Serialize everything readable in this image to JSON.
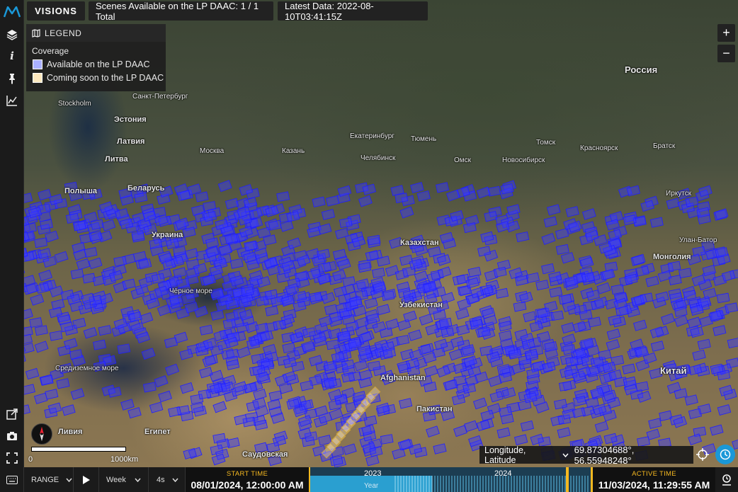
{
  "app": {
    "logo_icon": "m-logo-icon",
    "brand_color": "#1a98d8",
    "accent_color": "#f5b820"
  },
  "header": {
    "visions_label": "VISIONS",
    "scenes_text": "Scenes Available on the LP DAAC: 1 / 1 Total",
    "latest_data_text": "Latest Data: 2022-08-10T03:41:15Z"
  },
  "sidebar": {
    "tools": [
      {
        "icon": "layers-icon"
      },
      {
        "icon": "info-icon"
      },
      {
        "icon": "pin-icon"
      },
      {
        "icon": "chart-icon"
      }
    ],
    "bottom_tools": [
      {
        "icon": "external-link-icon"
      },
      {
        "icon": "camera-icon"
      },
      {
        "icon": "fullscreen-icon"
      },
      {
        "icon": "keyboard-icon"
      }
    ]
  },
  "legend": {
    "title": "LEGEND",
    "subtitle": "Coverage",
    "items": [
      {
        "label": "Available on the LP DAAC",
        "color": "#aab0ff"
      },
      {
        "label": "Coming soon to the LP DAAC",
        "color": "#fde9bf"
      }
    ]
  },
  "map": {
    "coverage_color": "#2020ff",
    "coming_soon_color": "#d4a630",
    "places": [
      {
        "name": "Россия"
      },
      {
        "name": "Полыша"
      },
      {
        "name": "Беларусь"
      },
      {
        "name": "Латвия"
      },
      {
        "name": "Литва"
      },
      {
        "name": "Эстония"
      },
      {
        "name": "Stockholm"
      },
      {
        "name": "Санкт-Петербург"
      },
      {
        "name": "Москва"
      },
      {
        "name": "Казань"
      },
      {
        "name": "Екатеринбург"
      },
      {
        "name": "Тюмень"
      },
      {
        "name": "Челябинск"
      },
      {
        "name": "Омск"
      },
      {
        "name": "Новосибирск"
      },
      {
        "name": "Томск"
      },
      {
        "name": "Красноярск"
      },
      {
        "name": "Братск"
      },
      {
        "name": "Иркутск"
      },
      {
        "name": "Улан-Батор"
      },
      {
        "name": "Монголия"
      },
      {
        "name": "Казахстан"
      },
      {
        "name": "Узбекистан"
      },
      {
        "name": "Afghanistan"
      },
      {
        "name": "Пакистан"
      },
      {
        "name": "Китай"
      },
      {
        "name": "Средиземное море"
      },
      {
        "name": "Ливия"
      },
      {
        "name": "Египет"
      },
      {
        "name": "Саудовская"
      },
      {
        "name": "Украина"
      },
      {
        "name": "Чёрное море"
      }
    ]
  },
  "zoom": {
    "in": "+",
    "out": "−"
  },
  "coordinates": {
    "type_label": "Longitude, Latitude",
    "value": "69.87304688°, 56.55948248°"
  },
  "scale": {
    "zero": "0",
    "distance": "1000km"
  },
  "timeline": {
    "range_label": "RANGE",
    "step_label": "Week",
    "speed_label": "4s",
    "start_time_label": "START TIME",
    "start_time_value": "08/01/2024, 12:00:00 AM",
    "active_time_label": "ACTIVE TIME",
    "active_time_value": "11/03/2024, 11:29:55 AM",
    "year_2023": "2023",
    "year_2024": "2024",
    "axis_unit": "Year"
  }
}
